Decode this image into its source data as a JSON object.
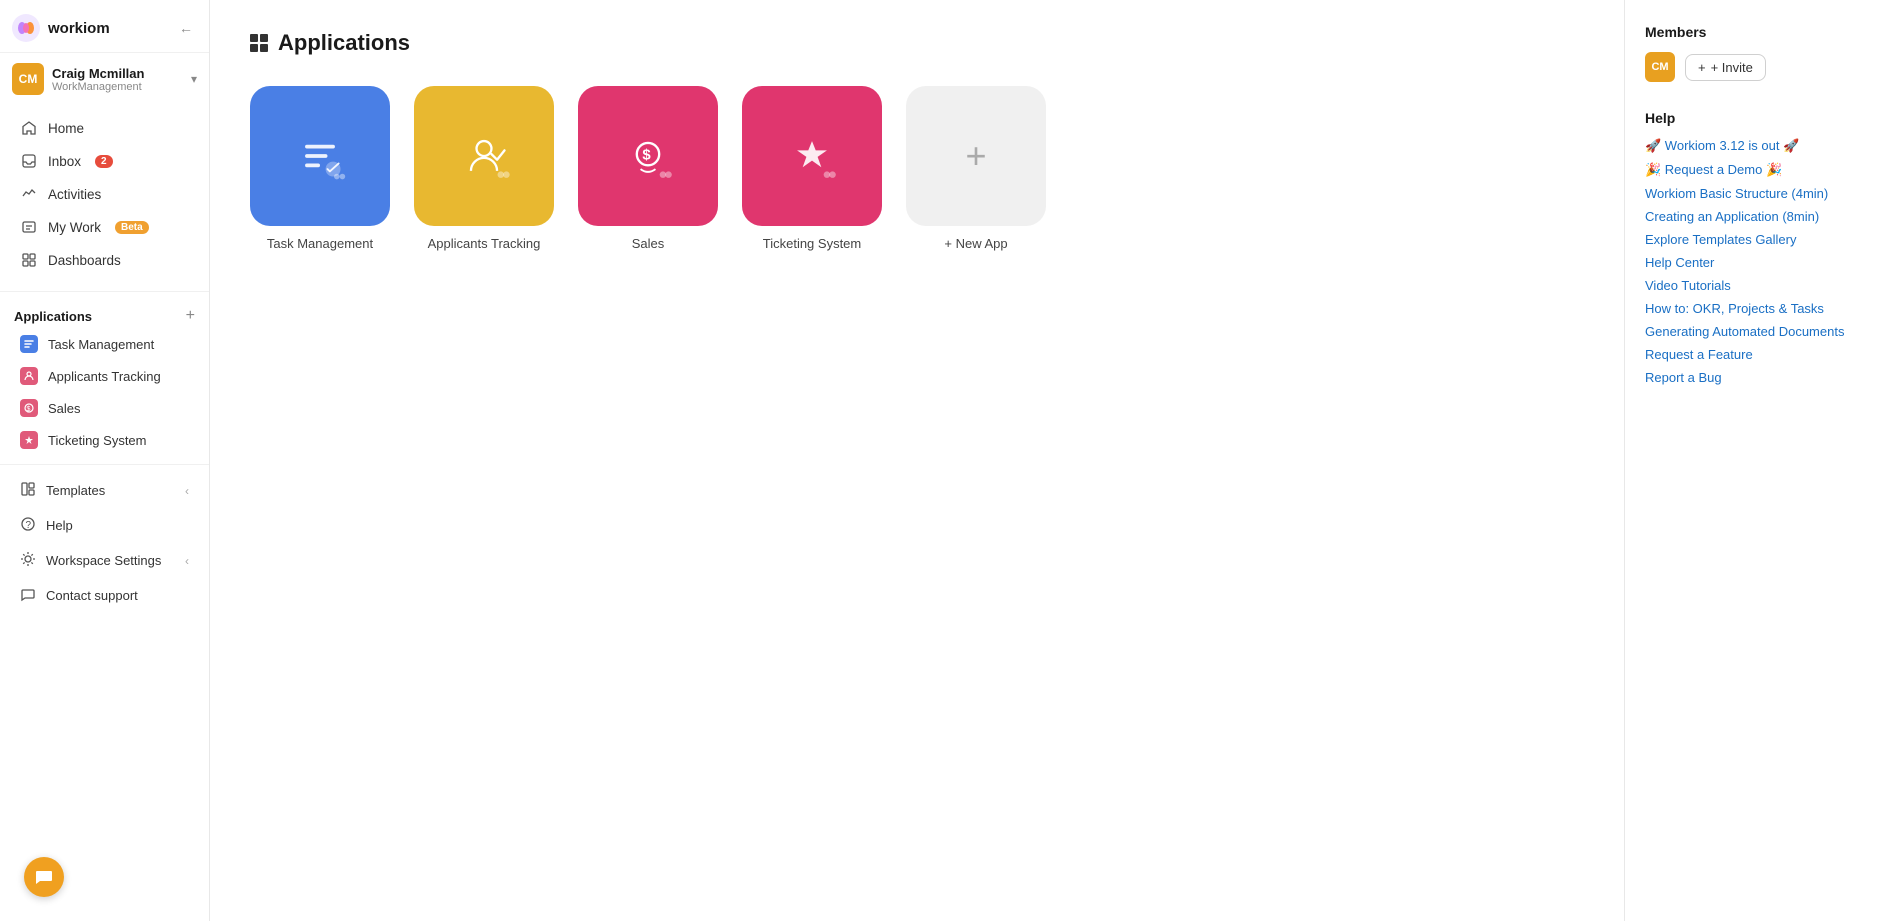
{
  "app": {
    "name": "workiom"
  },
  "user": {
    "initials": "CM",
    "name": "Craig Mcmillan",
    "workspace": "WorkManagement",
    "avatar_color": "#e8a020"
  },
  "sidebar": {
    "nav_items": [
      {
        "id": "home",
        "label": "Home",
        "icon": "home"
      },
      {
        "id": "inbox",
        "label": "Inbox",
        "icon": "inbox",
        "badge": "2"
      },
      {
        "id": "activities",
        "label": "Activities",
        "icon": "activities"
      },
      {
        "id": "mywork",
        "label": "My Work",
        "icon": "mywork",
        "beta": true
      },
      {
        "id": "dashboards",
        "label": "Dashboards",
        "icon": "dashboards"
      }
    ],
    "applications_section": "Applications",
    "applications": [
      {
        "id": "task-management",
        "label": "Task Management",
        "color": "#4a7fe5",
        "icon": "list"
      },
      {
        "id": "applicants-tracking",
        "label": "Applicants Tracking",
        "color": "#e05a7a",
        "icon": "user-check"
      },
      {
        "id": "sales",
        "label": "Sales",
        "color": "#e05a7a",
        "icon": "dollar"
      },
      {
        "id": "ticketing-system",
        "label": "Ticketing System",
        "color": "#e05a7a",
        "icon": "fire"
      }
    ],
    "templates": "Templates",
    "help": "Help",
    "workspace_settings": "Workspace Settings",
    "contact_support": "Contact support"
  },
  "main": {
    "page_title": "Applications",
    "apps": [
      {
        "id": "task-management",
        "label": "Task Management",
        "bg": "#4a7fe5"
      },
      {
        "id": "applicants-tracking",
        "label": "Applicants Tracking",
        "bg": "#e8b830"
      },
      {
        "id": "sales",
        "label": "Sales",
        "bg": "#e0366e"
      },
      {
        "id": "ticketing-system",
        "label": "Ticketing System",
        "bg": "#e0366e"
      }
    ],
    "new_app_label": "+ New App"
  },
  "right_panel": {
    "members_title": "Members",
    "member_initials": "CM",
    "invite_label": "+ Invite",
    "help_title": "Help",
    "help_links": [
      {
        "id": "release",
        "label": "🚀 Workiom 3.12 is out 🚀"
      },
      {
        "id": "demo",
        "label": "🎉 Request a Demo 🎉"
      },
      {
        "id": "basic-structure",
        "label": "Workiom Basic Structure (4min)"
      },
      {
        "id": "creating-app",
        "label": "Creating an Application (8min)"
      },
      {
        "id": "templates-gallery",
        "label": "Explore Templates Gallery"
      },
      {
        "id": "help-center",
        "label": "Help Center"
      },
      {
        "id": "video-tutorials",
        "label": "Video Tutorials"
      },
      {
        "id": "okr-projects",
        "label": "How to: OKR, Projects & Tasks"
      },
      {
        "id": "automated-docs",
        "label": "Generating Automated Documents"
      },
      {
        "id": "request-feature",
        "label": "Request a Feature"
      },
      {
        "id": "report-bug",
        "label": "Report a Bug"
      }
    ]
  }
}
